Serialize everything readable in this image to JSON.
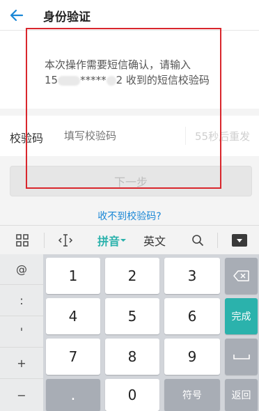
{
  "header": {
    "title": "身份验证",
    "back_icon": "back-arrow-icon",
    "accent": "#1a87d6"
  },
  "message": {
    "line1": "本次操作需要短信确认，请输入",
    "phone_prefix": "15",
    "phone_mask": "*****",
    "phone_suffix": "2 收到的短信校验码"
  },
  "code_field": {
    "label": "校验码",
    "placeholder": "填写校验码",
    "value": "",
    "resend": "55秒后重发"
  },
  "next_button": {
    "label": "下一步"
  },
  "no_code_link": "收不到校验码?",
  "keyboard_toolbar": {
    "grid_icon": "grid-icon",
    "cursor_icon": "cursor-icon",
    "pinyin": "拼音",
    "english": "英文",
    "search_icon": "search-icon",
    "hide_icon": "hide-keyboard-icon"
  },
  "keyboard": {
    "symbols": [
      "@",
      ":",
      "'",
      "+",
      "−"
    ],
    "digits": [
      "1",
      "2",
      "3",
      "4",
      "5",
      "6",
      "7",
      "8",
      "9",
      "0"
    ],
    "dot": ".",
    "symbols_key": "符号",
    "back_key": "返回",
    "done_key": "完成",
    "backspace_icon": "backspace-icon",
    "space_icon": "space-icon",
    "accent": "#2bb2ac"
  }
}
